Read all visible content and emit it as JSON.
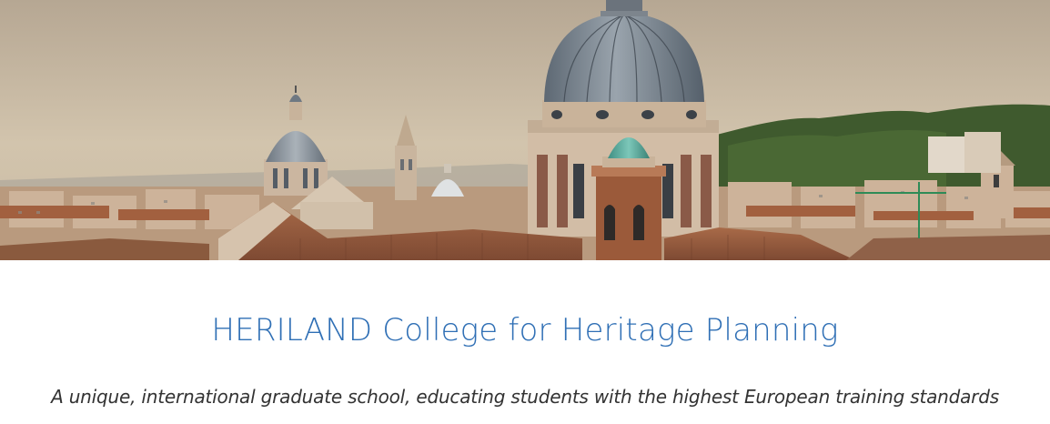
{
  "hero": {
    "image_subject": "rome-skyline-domes-photo",
    "colors": {
      "sky": "#cdbfa8",
      "dome": "#6f7a86",
      "roof_terracotta": "#9b5a3a",
      "stone": "#cdb9a0",
      "greenery": "#3f5a2e",
      "copper_cupola": "#4fa89a"
    }
  },
  "heading": {
    "title": "HERILAND College for Heritage Planning",
    "subtitle": "A unique, international graduate school, educating students with the highest European training standards"
  },
  "colors": {
    "title": "#2f6fb5",
    "subtitle": "#333333",
    "background": "#ffffff"
  }
}
